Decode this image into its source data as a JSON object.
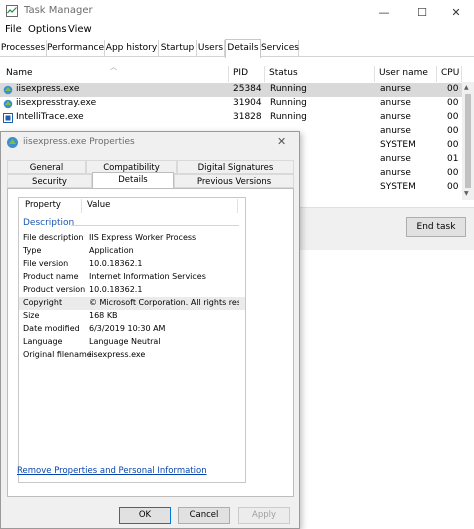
{
  "task_manager": {
    "title": "Task Manager",
    "window_buttons": [
      "—",
      "☐",
      "✕"
    ],
    "menu": [
      "File",
      "Options",
      "View"
    ],
    "tabs": [
      "Processes",
      "Performance",
      "App history",
      "Startup",
      "Users",
      "Details",
      "Services"
    ],
    "active_tab": "Details",
    "columns": [
      "Name",
      "PID",
      "Status",
      "User name",
      "CPU"
    ],
    "rows": [
      {
        "name": "iisexpress.exe",
        "pid": "25384",
        "status": "Running",
        "user": "anurse",
        "cpu": "00",
        "selected": true
      },
      {
        "name": "iisexpresstray.exe",
        "pid": "31904",
        "status": "Running",
        "user": "anurse",
        "cpu": "00"
      },
      {
        "name": "IntelliTrace.exe",
        "pid": "31828",
        "status": "Running",
        "user": "anurse",
        "cpu": "00"
      },
      {
        "name": "",
        "pid": "",
        "status": "",
        "user": "anurse",
        "cpu": "00"
      },
      {
        "name": "",
        "pid": "",
        "status": "",
        "user": "SYSTEM",
        "cpu": "00"
      },
      {
        "name": "",
        "pid": "",
        "status": "",
        "user": "anurse",
        "cpu": "01"
      },
      {
        "name": "",
        "pid": "",
        "status": "",
        "user": "anurse",
        "cpu": "00"
      },
      {
        "name": "",
        "pid": "",
        "status": "",
        "user": "SYSTEM",
        "cpu": "00"
      }
    ],
    "end_task": "End task"
  },
  "properties_dialog": {
    "title": "iisexpress.exe Properties",
    "close": "✕",
    "tabs_row1": [
      "General",
      "Compatibility",
      "Digital Signatures"
    ],
    "tabs_row2": [
      "Security",
      "Details",
      "Previous Versions"
    ],
    "active_tab": "Details",
    "list_headers": {
      "property": "Property",
      "value": "Value"
    },
    "group": "Description",
    "properties": [
      {
        "name": "File description",
        "value": "IIS Express Worker Process"
      },
      {
        "name": "Type",
        "value": "Application"
      },
      {
        "name": "File version",
        "value": "10.0.18362.1"
      },
      {
        "name": "Product name",
        "value": "Internet Information Services"
      },
      {
        "name": "Product version",
        "value": "10.0.18362.1"
      },
      {
        "name": "Copyright",
        "value": "© Microsoft Corporation. All rights reserv...",
        "highlighted": true
      },
      {
        "name": "Size",
        "value": "168 KB"
      },
      {
        "name": "Date modified",
        "value": "6/3/2019 10:30 AM"
      },
      {
        "name": "Language",
        "value": "Language Neutral"
      },
      {
        "name": "Original filename",
        "value": "iisexpress.exe"
      }
    ],
    "remove_link": "Remove Properties and Personal Information",
    "buttons": {
      "ok": "OK",
      "cancel": "Cancel",
      "apply": "Apply"
    }
  },
  "colors": {
    "selection": "#d9d9d9",
    "link": "#0645ad",
    "group_header": "#1a56b4",
    "dialog_bg": "#f0f0f0"
  }
}
